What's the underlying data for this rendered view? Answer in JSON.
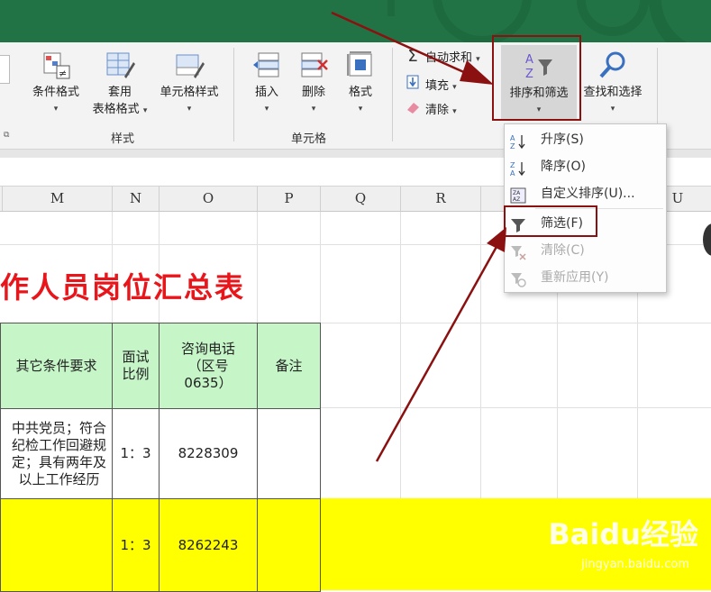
{
  "ribbon": {
    "styles_group": {
      "label": "样式",
      "conditional_format": "条件格式",
      "table_format_line1": "套用",
      "table_format_line2": "表格格式",
      "cell_styles": "单元格样式"
    },
    "cells_group": {
      "label": "单元格",
      "insert": "插入",
      "delete": "删除",
      "format": "格式"
    },
    "editing_group": {
      "autosum": "自动求和",
      "fill": "填充",
      "clear": "清除",
      "sort_filter": "排序和筛选",
      "find_select": "查找和选择"
    }
  },
  "columns": [
    "M",
    "N",
    "O",
    "P",
    "Q",
    "R",
    "U"
  ],
  "sheet": {
    "title": "工作人员岗位汇总表",
    "headers": {
      "other_requirements": "其它条件要求",
      "interview_ratio": "面试比例",
      "phone": "咨询电话（区号0635）",
      "remarks": "备注"
    },
    "rows": [
      {
        "requirements": "中共党员；符合纪检工作回避规定；具有两年及以上工作经历",
        "ratio": "1：3",
        "phone": "8228309",
        "remarks": ""
      },
      {
        "requirements": "",
        "ratio": "1：3",
        "phone": "8262243",
        "remarks": ""
      }
    ]
  },
  "sort_menu": {
    "items": [
      {
        "label": "升序(S)",
        "icon": "sort-ascending-icon",
        "enabled": true
      },
      {
        "label": "降序(O)",
        "icon": "sort-descending-icon",
        "enabled": true
      },
      {
        "label": "自定义排序(U)...",
        "icon": "custom-sort-icon",
        "enabled": true
      },
      {
        "label": "筛选(F)",
        "icon": "filter-icon",
        "enabled": true
      },
      {
        "label": "清除(C)",
        "icon": "clear-filter-icon",
        "enabled": false
      },
      {
        "label": "重新应用(Y)",
        "icon": "reapply-icon",
        "enabled": false
      }
    ]
  },
  "watermark": {
    "brand": "Baidu经验",
    "url": "jingyan.baidu.com"
  },
  "colors": {
    "title_bar": "#217346",
    "annotation": "#8b1111",
    "sheet_title": "#e8161b",
    "header_fill": "#c6f5c8",
    "highlight_row": "#ffff00"
  }
}
